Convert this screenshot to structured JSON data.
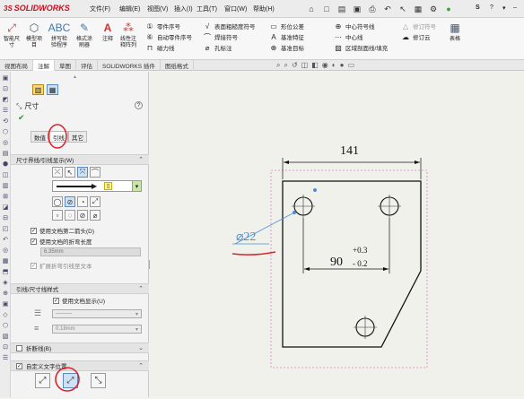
{
  "app": {
    "brand": "SOLIDWORKS",
    "brand_prefix": "3S"
  },
  "menu": [
    "文件(F)",
    "编辑(E)",
    "视图(V)",
    "插入(I)",
    "工具(T)",
    "窗口(W)",
    "帮助(H)"
  ],
  "qat_right": [
    "S",
    "?"
  ],
  "ribbon": {
    "big": [
      {
        "label": "智能尺寸",
        "icon": "smart-dimension"
      },
      {
        "label": "模型项目",
        "icon": "model-items"
      },
      {
        "label": "拼写检验程序",
        "icon": "spell-check"
      },
      {
        "label": "格式涂刷器",
        "icon": "format-painter"
      },
      {
        "label": "注释",
        "icon": "note"
      },
      {
        "label": "线性注释阵列",
        "icon": "linear-pattern"
      }
    ],
    "col1": [
      "零件序号",
      "自动零件序号",
      "磁力线"
    ],
    "col2": [
      "表面粗糙度符号",
      "焊接符号",
      "孔标注"
    ],
    "col3": [
      "形位公差",
      "基准特征",
      "基准目标"
    ],
    "col4": [
      "中心符号线",
      "中心线",
      "区域剖面线/填充"
    ],
    "col5": [
      "修订符号",
      "修订云"
    ],
    "last": "表格"
  },
  "tabs": [
    "视图布局",
    "注解",
    "草图",
    "评估",
    "SOLIDWORKS 插件",
    "图纸格式"
  ],
  "active_tab": "注解",
  "pm": {
    "title": "尺寸",
    "subtabs": [
      "数值",
      "引线",
      "其它"
    ],
    "sections": {
      "witness": "尺寸界线/引线显示(W)",
      "leader_style": "引线/尺寸线样式",
      "break": "折断线(B)",
      "custom_text": "自定义文字位置"
    },
    "options": {
      "use_doc_second_arrow": "使用文档第二箭头(D)",
      "use_doc_bend_length": "使用文档的折弯长度",
      "bend_length_value": "6.35mm",
      "extend_leader": "扩展折弯引线至文本",
      "use_doc_display": "使用文档显示(U)",
      "line_thickness": "0.18mm"
    }
  },
  "drawing": {
    "dim_width": "141",
    "diameter": "⌀22",
    "dim_horizontal": "90",
    "tol_upper": "+0.3",
    "tol_lower": "- 0.2"
  },
  "colors": {
    "annotation_red": "#d9262b",
    "selected_blue": "#4a8fd6"
  }
}
